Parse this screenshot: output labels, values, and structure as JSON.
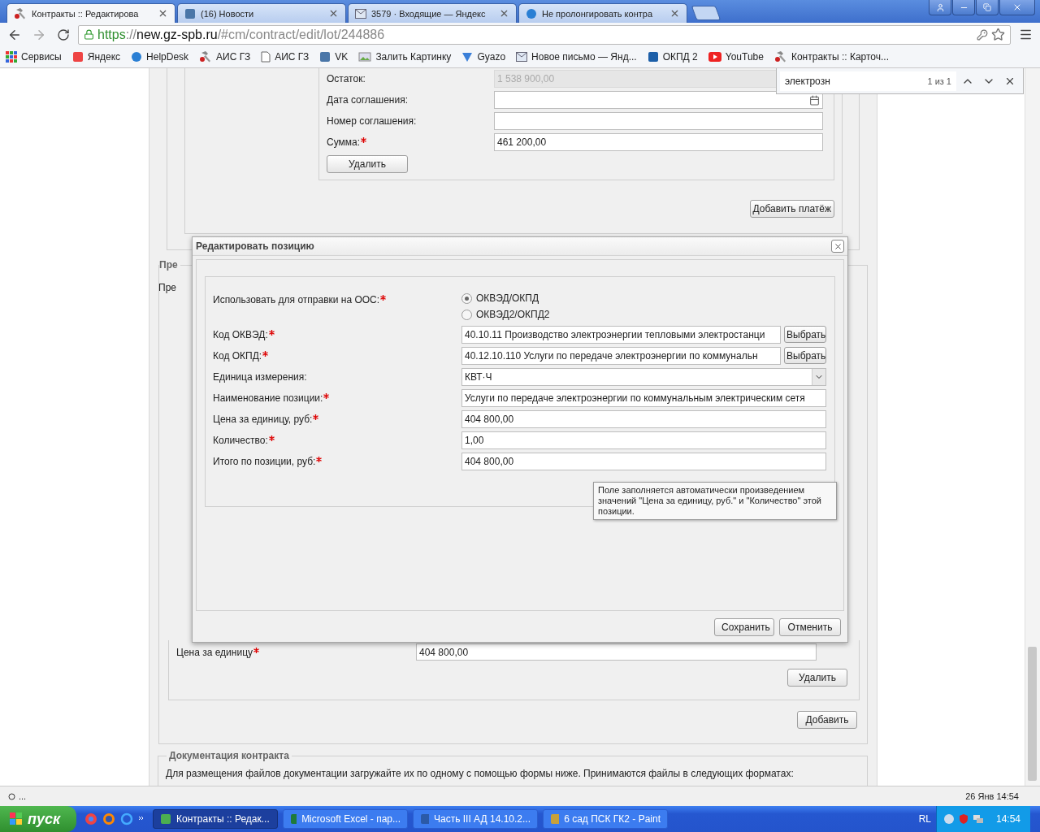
{
  "browser": {
    "tabs": [
      {
        "title": "Контракты :: Редактирова",
        "selected": true
      },
      {
        "title": "(16) Новости",
        "selected": false
      },
      {
        "title": "3579 · Входящие — Яндекс",
        "selected": false
      },
      {
        "title": "Не пролонгировать контра",
        "selected": false
      }
    ],
    "address": {
      "scheme": "https",
      "separator": "://",
      "host": "new.gz-spb.ru",
      "path": "/#cm/contract/edit/lot/244886"
    },
    "bookmarks": [
      "Сервисы",
      "Яндекс",
      "HelpDesk",
      "АИС ГЗ",
      "АИС ГЗ",
      "VK",
      "Залить Картинку",
      "Gyazo",
      "Новое письмо — Янд...",
      "ОКПД 2",
      "YouTube",
      "Контракты :: Карточ..."
    ],
    "find_bar": {
      "query": "электрозн",
      "count": "1 из 1"
    }
  },
  "page": {
    "payment": {
      "fields": [
        {
          "label": "Остаток:",
          "required": false,
          "kind": "text",
          "value": "1 538 900,00",
          "disabled": true
        },
        {
          "label": "Дата соглашения:",
          "required": false,
          "kind": "date",
          "disabled": false
        },
        {
          "label": "Номер соглашения:",
          "required": false,
          "kind": "text",
          "disabled": false
        },
        {
          "label": "Сумма:",
          "required": true,
          "kind": "text",
          "value": "461 200,00",
          "disabled": false
        }
      ],
      "delete_button": "Удалить"
    },
    "add_payment_button": "Добавить платёж",
    "section": {
      "legend": "Пре",
      "text": "Пре"
    },
    "item": {
      "label": "Цена за единицу",
      "required": true,
      "value": "404 800,00",
      "delete_button": "Удалить"
    },
    "add_button": "Добавить",
    "documents": {
      "legend": "Документация контракта",
      "text": "Для размещения файлов документации загружайте их по одному с помощью формы ниже. Принимаются файлы в следующих форматах:"
    }
  },
  "dialog": {
    "title": "Редактировать позицию",
    "fields": [
      {
        "kind": "radio",
        "label": "Использовать для отправки на ООС:",
        "required": true,
        "options": [
          {
            "label": "ОКВЭД/ОКПД",
            "selected": true
          },
          {
            "label": "ОКВЭД2/ОКПД2",
            "selected": false
          }
        ]
      },
      {
        "kind": "picker",
        "label": "Код ОКВЭД:",
        "required": true,
        "value": "40.10.11 Производство электроэнергии тепловыми электростанци",
        "button": "Выбрать"
      },
      {
        "kind": "picker",
        "label": "Код ОКПД:",
        "required": true,
        "value": "40.12.10.110 Услуги по передаче электроэнергии по коммунальн",
        "button": "Выбрать"
      },
      {
        "kind": "select",
        "label": "Единица измерения:",
        "required": false,
        "value": "КВТ·Ч"
      },
      {
        "kind": "text",
        "label": "Наименование позиции:",
        "required": true,
        "value": "Услуги по передаче электроэнергии по коммунальным электрическим сетя"
      },
      {
        "kind": "text",
        "label": "Цена за единицу, руб:",
        "required": true,
        "value": "404 800,00"
      },
      {
        "kind": "text",
        "label": "Количество:",
        "required": true,
        "value": "1,00"
      },
      {
        "kind": "text",
        "label": "Итого по позиции, руб:",
        "required": true,
        "value": "404 800,00"
      }
    ],
    "tooltip": "Поле заполняется автоматически произведением значений \"Цена за единицу, руб.\" и \"Количество\" этой позиции.",
    "buttons": [
      "Сохранить",
      "Отменить"
    ]
  },
  "status_bar": {
    "left": "...",
    "right": "26 Янв 14:54"
  },
  "taskbar": {
    "start": "пуск",
    "tasks": [
      {
        "title": "Контракты :: Редак...",
        "selected": true
      },
      {
        "title": "Microsoft Excel - пар...",
        "selected": false
      },
      {
        "title": "Часть III АД 14.10.2...",
        "selected": false
      },
      {
        "title": "6 сад ПСК ГК2 - Paint",
        "selected": false
      }
    ],
    "language": "RL",
    "clock": "14:54"
  }
}
